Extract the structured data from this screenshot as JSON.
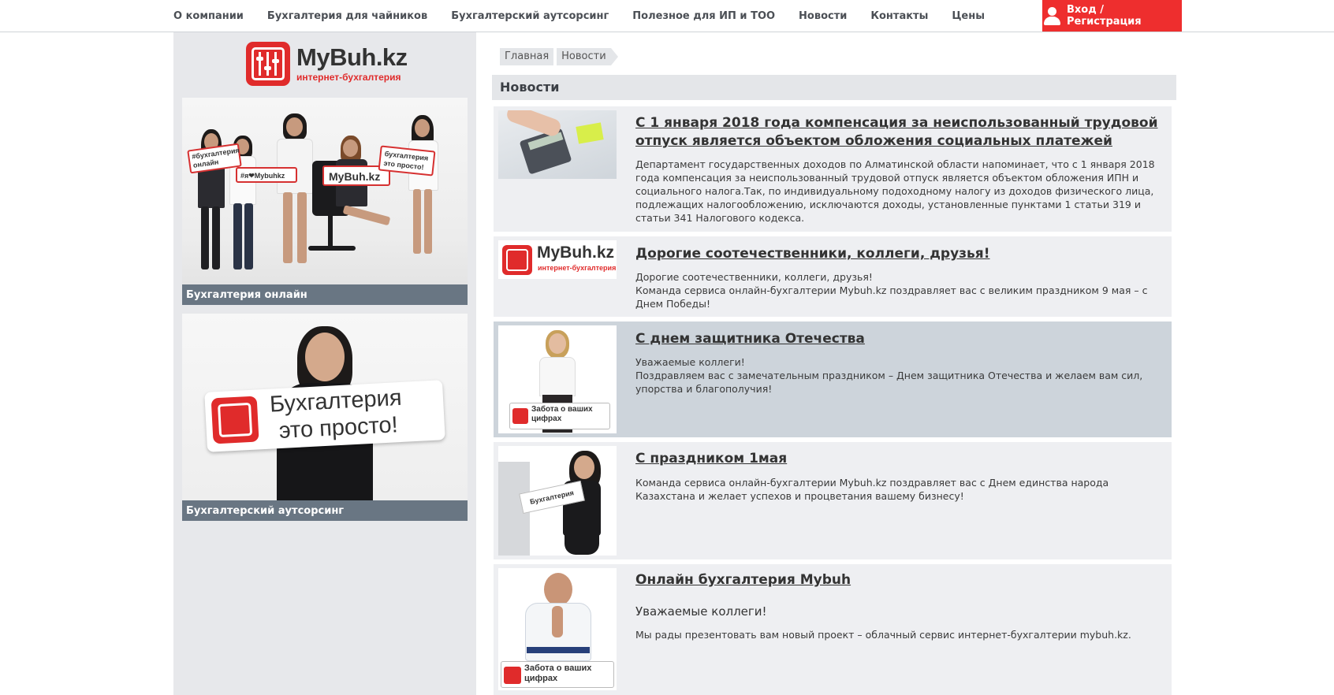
{
  "nav": {
    "items": [
      {
        "label": "О компании"
      },
      {
        "label": "Бухгалтерия для чайников"
      },
      {
        "label": "Бухгалтерский аутсорсинг"
      },
      {
        "label": "Полезное для ИП и ТОО"
      },
      {
        "label": "Новости"
      },
      {
        "label": "Контакты"
      },
      {
        "label": "Цены"
      }
    ],
    "login_label": "Вход / Регистрация"
  },
  "logo": {
    "title": "MyBuh.kz",
    "subtitle": "интернет-бухгалтерия"
  },
  "sidebar": {
    "promos": [
      {
        "caption": "Бухгалтерия онлайн",
        "sign1": "#бухгалтерия онлайн",
        "sign2": "#я❤Mybuhkz",
        "sign3": "MyBuh.kz",
        "sign4": "бухгалтерия это просто!"
      },
      {
        "caption": "Бухгалтерский аутсорсинг",
        "sign_line1": "Бухгалтерия",
        "sign_line2": "это просто!"
      }
    ]
  },
  "breadcrumb": {
    "home": "Главная",
    "current": "Новости"
  },
  "section_title": "Новости",
  "news": [
    {
      "title": "С 1 января 2018 года компенсация за неиспользованный трудовой отпуск является объектом обложения социальных платежей",
      "text": "Департамент государственных доходов по Алматинской области напоминает, что с 1 января 2018 года компенсация за неиспользованный трудовой отпуск является объектом обложения ИПН и социального налога.Так, по индивидуальному подоходному налогу из доходов физического лица, подлежащих налогообложению, исключаются доходы, установленные пунктами 1 статьи 319 и статьи 341 Налогового кодекса."
    },
    {
      "title": "Дорогие соотечественники, коллеги, друзья!",
      "text_line1": "Дорогие соотечественники, коллеги, друзья!",
      "text_line2": "Команда сервиса онлайн-бухгалтерии Mybuh.kz поздравляет вас с великим праздником 9 мая – с Днем Победы!",
      "thumb_title": "MyBuh.kz",
      "thumb_sub": "интернет-бухгалтерия"
    },
    {
      "title": "С днем защитника Отечества",
      "text_line1": "Уважаемые коллеги!",
      "text_line2": "Поздравляем вас с замечательным праздником – Днем защитника Отечества и желаем вам сил, упорства и благополучия!",
      "thumb_sign": "Забота о ваших цифрах"
    },
    {
      "title": "С праздником 1мая",
      "text": "Команда сервиса онлайн-бухгалтерии Mybuh.kz поздравляет вас с Днем единства народа Казахстана и желает успехов и процветания вашему бизнесу!",
      "thumb_sign": "Бухгалтерия"
    },
    {
      "title": "Онлайн бухгалтерия Mybuh",
      "lead": "Уважаемые коллеги!",
      "text": "Мы рады презентовать вам новый проект – облачный сервис интернет-бухгалтерии mybuh.kz.",
      "thumb_sign": "Забота о ваших цифрах"
    }
  ],
  "colors": {
    "accent": "#ee2e2e",
    "caption_bg": "#697683",
    "sidebar_bg": "#e7e8eb",
    "news_bg": "#eeeff2",
    "news_active_bg": "#cdd4db"
  }
}
